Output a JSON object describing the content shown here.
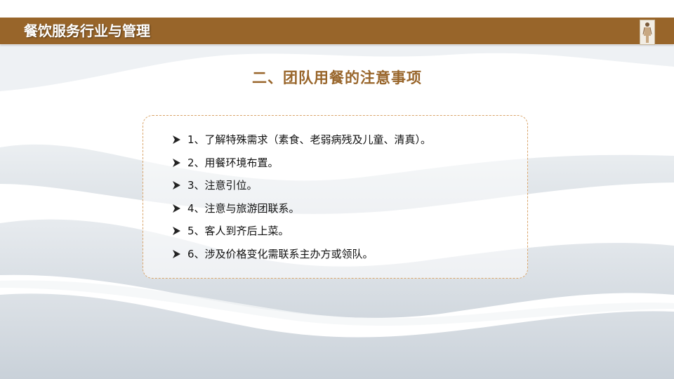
{
  "header": {
    "title": "餐饮服务行业与管理",
    "figure_icon": "standing-figure-icon",
    "bar_color": "#98652a"
  },
  "section": {
    "title": "二、团队用餐的注意事项",
    "color": "#98652a"
  },
  "content": {
    "bullet_icon": "arrow-bullet-icon",
    "items": [
      "1、了解特殊需求（素食、老弱病残及儿童、清真）。",
      "2、用餐环境布置。",
      "3、注意引位。",
      "4、注意与旅游团联系。",
      "5、客人到齐后上菜。",
      "6、涉及价格变化需联系主办方或领队。"
    ],
    "border_color": "#d9a46a"
  }
}
